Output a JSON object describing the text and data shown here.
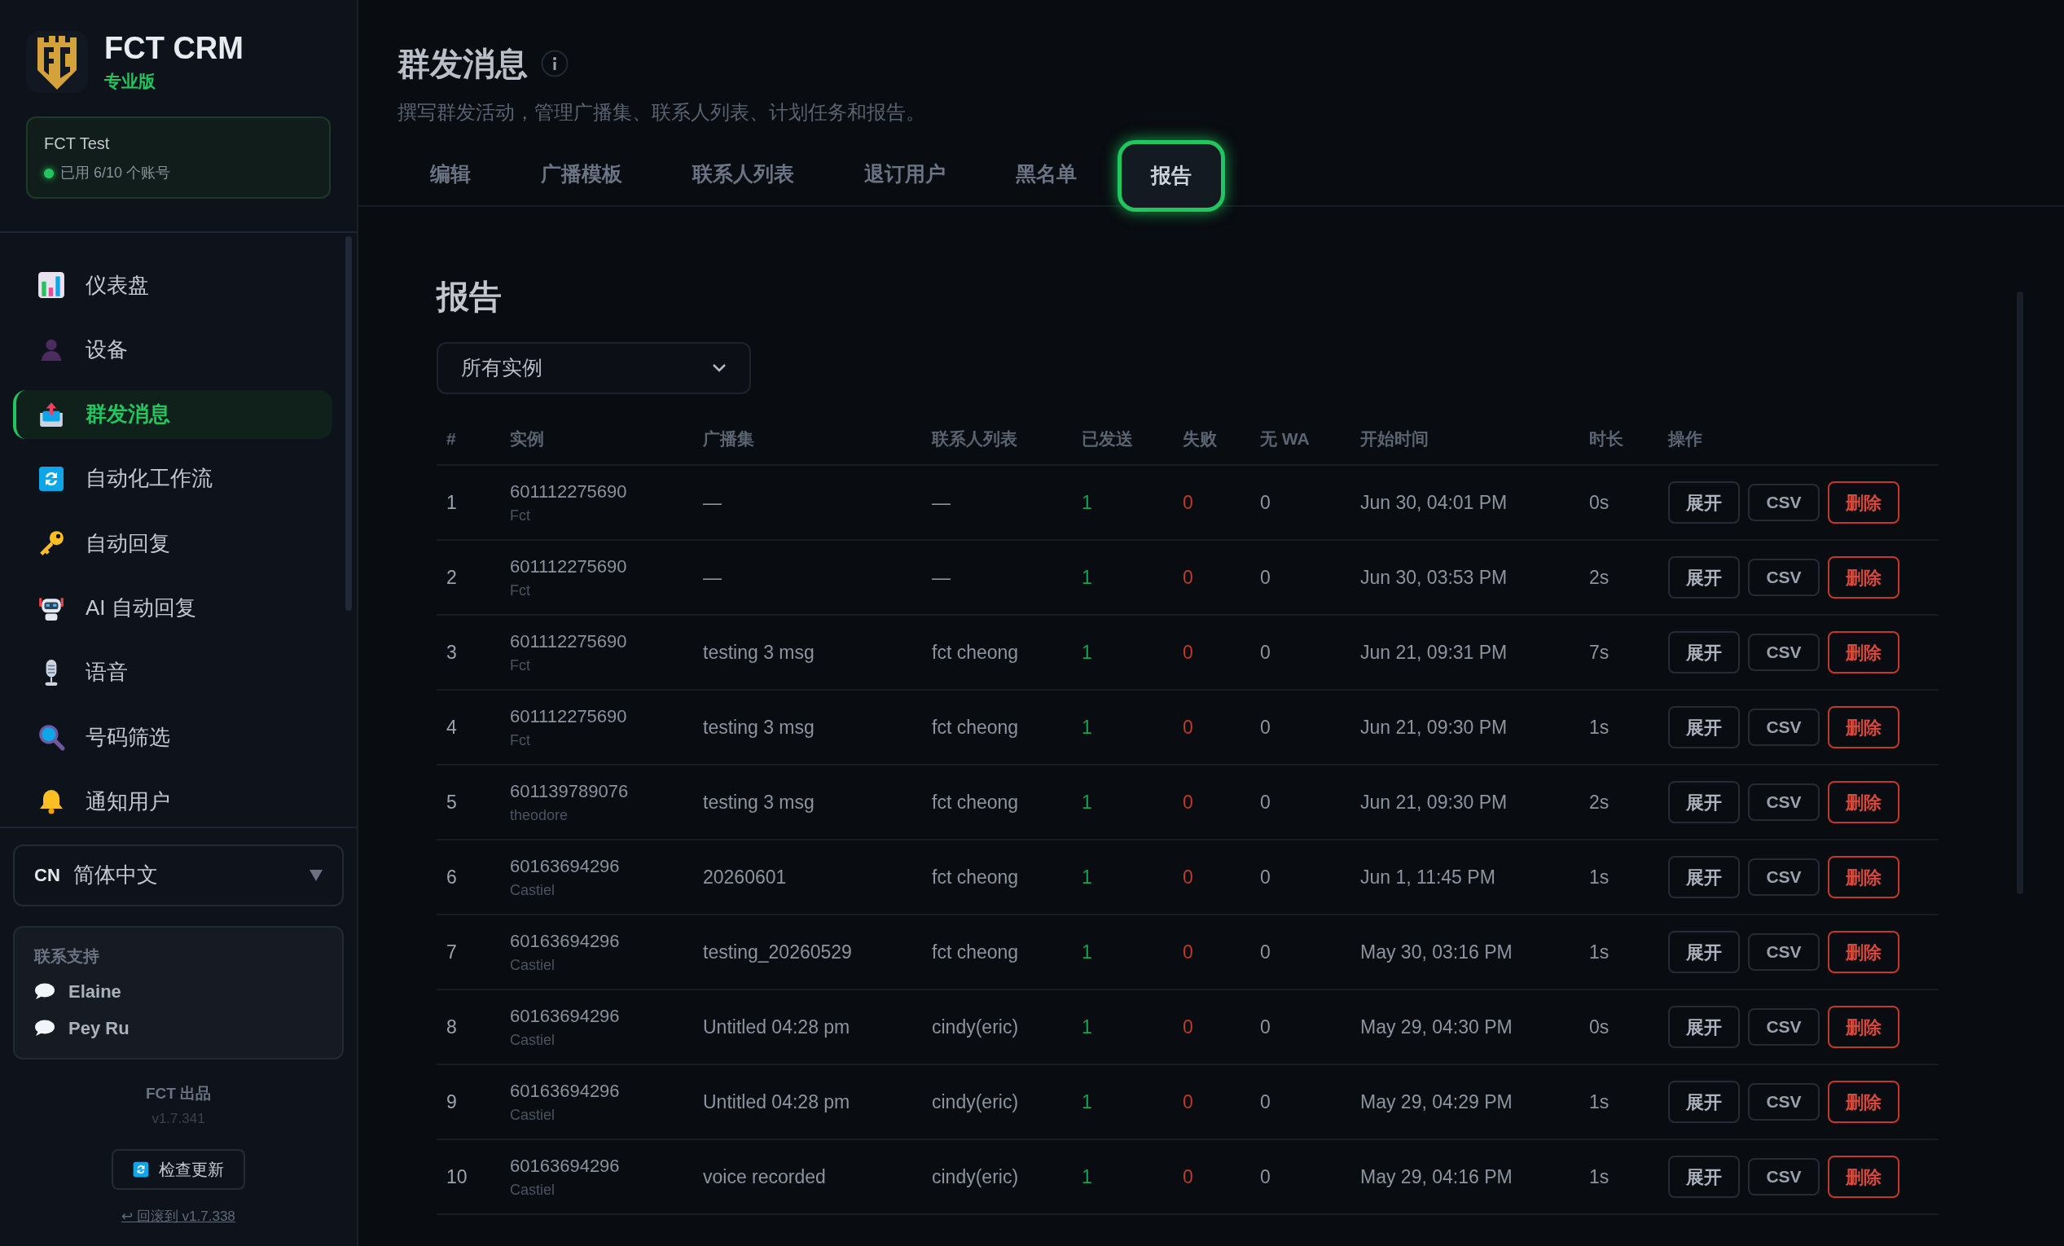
{
  "brand": {
    "name": "FCT CRM",
    "edition": "专业版"
  },
  "account": {
    "name": "FCT Test",
    "usage": "已用 6/10 个账号"
  },
  "nav": [
    {
      "label": "仪表盘",
      "selected": false
    },
    {
      "label": "设备",
      "selected": false
    },
    {
      "label": "群发消息",
      "selected": true
    },
    {
      "label": "自动化工作流",
      "selected": false
    },
    {
      "label": "自动回复",
      "selected": false
    },
    {
      "label": "AI 自动回复",
      "selected": false
    },
    {
      "label": "语音",
      "selected": false
    },
    {
      "label": "号码筛选",
      "selected": false
    },
    {
      "label": "通知用户",
      "selected": false
    }
  ],
  "language": {
    "code": "CN",
    "label": "简体中文"
  },
  "support": {
    "title": "联系支持",
    "contacts": [
      "Elaine",
      "Pey Ru"
    ]
  },
  "footer": {
    "credit": "FCT 出品",
    "version": "v1.7.341",
    "update_button": "检查更新",
    "rollback_link": "↩ 回滚到 v1.7.338"
  },
  "page": {
    "title": "群发消息",
    "subtitle": "撰写群发活动，管理广播集、联系人列表、计划任务和报告。"
  },
  "tabs": [
    {
      "label": "编辑",
      "selected": false
    },
    {
      "label": "广播模板",
      "selected": false
    },
    {
      "label": "联系人列表",
      "selected": false
    },
    {
      "label": "退订用户",
      "selected": false
    },
    {
      "label": "黑名单",
      "selected": false
    },
    {
      "label": "报告",
      "selected": true
    }
  ],
  "report": {
    "title": "报告",
    "filter": "所有实例",
    "columns": [
      "#",
      "实例",
      "广播集",
      "联系人列表",
      "已发送",
      "失败",
      "无 WA",
      "开始时间",
      "时长",
      "操作"
    ],
    "rows": [
      {
        "index": "1",
        "instance": "601112275690",
        "instance_name": "Fct",
        "broadcast": "—",
        "contact_list": "—",
        "sent": "1",
        "failed": "0",
        "no_wa": "0",
        "start_time": "Jun 30, 04:01 PM",
        "duration": "0s",
        "actions": [
          {
            "kind": "expand",
            "label": "展开"
          },
          {
            "kind": "csv",
            "label": "CSV"
          },
          {
            "kind": "delete",
            "label": "删除"
          }
        ]
      },
      {
        "index": "2",
        "instance": "601112275690",
        "instance_name": "Fct",
        "broadcast": "—",
        "contact_list": "—",
        "sent": "1",
        "failed": "0",
        "no_wa": "0",
        "start_time": "Jun 30, 03:53 PM",
        "duration": "2s",
        "actions": [
          {
            "kind": "expand",
            "label": "展开"
          },
          {
            "kind": "csv",
            "label": "CSV"
          },
          {
            "kind": "delete",
            "label": "删除"
          }
        ]
      },
      {
        "index": "3",
        "instance": "601112275690",
        "instance_name": "Fct",
        "broadcast": "testing 3 msg",
        "contact_list": "fct cheong",
        "sent": "1",
        "failed": "0",
        "no_wa": "0",
        "start_time": "Jun 21, 09:31 PM",
        "duration": "7s",
        "actions": [
          {
            "kind": "expand",
            "label": "展开"
          },
          {
            "kind": "csv",
            "label": "CSV"
          },
          {
            "kind": "delete",
            "label": "删除"
          }
        ]
      },
      {
        "index": "4",
        "instance": "601112275690",
        "instance_name": "Fct",
        "broadcast": "testing 3 msg",
        "contact_list": "fct cheong",
        "sent": "1",
        "failed": "0",
        "no_wa": "0",
        "start_time": "Jun 21, 09:30 PM",
        "duration": "1s",
        "actions": [
          {
            "kind": "expand",
            "label": "展开"
          },
          {
            "kind": "csv",
            "label": "CSV"
          },
          {
            "kind": "delete",
            "label": "删除"
          }
        ]
      },
      {
        "index": "5",
        "instance": "601139789076",
        "instance_name": "theodore",
        "broadcast": "testing 3 msg",
        "contact_list": "fct cheong",
        "sent": "1",
        "failed": "0",
        "no_wa": "0",
        "start_time": "Jun 21, 09:30 PM",
        "duration": "2s",
        "actions": [
          {
            "kind": "expand",
            "label": "展开"
          },
          {
            "kind": "csv",
            "label": "CSV"
          },
          {
            "kind": "delete",
            "label": "删除"
          }
        ]
      },
      {
        "index": "6",
        "instance": "60163694296",
        "instance_name": "Castiel",
        "broadcast": "20260601",
        "contact_list": "fct cheong",
        "sent": "1",
        "failed": "0",
        "no_wa": "0",
        "start_time": "Jun 1, 11:45 PM",
        "duration": "1s",
        "actions": [
          {
            "kind": "expand",
            "label": "展开"
          },
          {
            "kind": "csv",
            "label": "CSV"
          },
          {
            "kind": "delete",
            "label": "删除"
          }
        ]
      },
      {
        "index": "7",
        "instance": "60163694296",
        "instance_name": "Castiel",
        "broadcast": "testing_20260529",
        "contact_list": "fct cheong",
        "sent": "1",
        "failed": "0",
        "no_wa": "0",
        "start_time": "May 30, 03:16 PM",
        "duration": "1s",
        "actions": [
          {
            "kind": "expand",
            "label": "展开"
          },
          {
            "kind": "csv",
            "label": "CSV"
          },
          {
            "kind": "delete",
            "label": "删除"
          }
        ]
      },
      {
        "index": "8",
        "instance": "60163694296",
        "instance_name": "Castiel",
        "broadcast": "Untitled 04:28 pm",
        "contact_list": "cindy(eric)",
        "sent": "1",
        "failed": "0",
        "no_wa": "0",
        "start_time": "May 29, 04:30 PM",
        "duration": "0s",
        "actions": [
          {
            "kind": "expand",
            "label": "展开"
          },
          {
            "kind": "csv",
            "label": "CSV"
          },
          {
            "kind": "delete",
            "label": "删除"
          }
        ]
      },
      {
        "index": "9",
        "instance": "60163694296",
        "instance_name": "Castiel",
        "broadcast": "Untitled 04:28 pm",
        "contact_list": "cindy(eric)",
        "sent": "1",
        "failed": "0",
        "no_wa": "0",
        "start_time": "May 29, 04:29 PM",
        "duration": "1s",
        "actions": [
          {
            "kind": "expand",
            "label": "展开"
          },
          {
            "kind": "csv",
            "label": "CSV"
          },
          {
            "kind": "delete",
            "label": "删除"
          }
        ]
      },
      {
        "index": "10",
        "instance": "60163694296",
        "instance_name": "Castiel",
        "broadcast": "voice recorded",
        "contact_list": "cindy(eric)",
        "sent": "1",
        "failed": "0",
        "no_wa": "0",
        "start_time": "May 29, 04:16 PM",
        "duration": "1s",
        "actions": [
          {
            "kind": "expand",
            "label": "展开"
          },
          {
            "kind": "csv",
            "label": "CSV"
          },
          {
            "kind": "delete",
            "label": "删除"
          }
        ]
      }
    ]
  }
}
